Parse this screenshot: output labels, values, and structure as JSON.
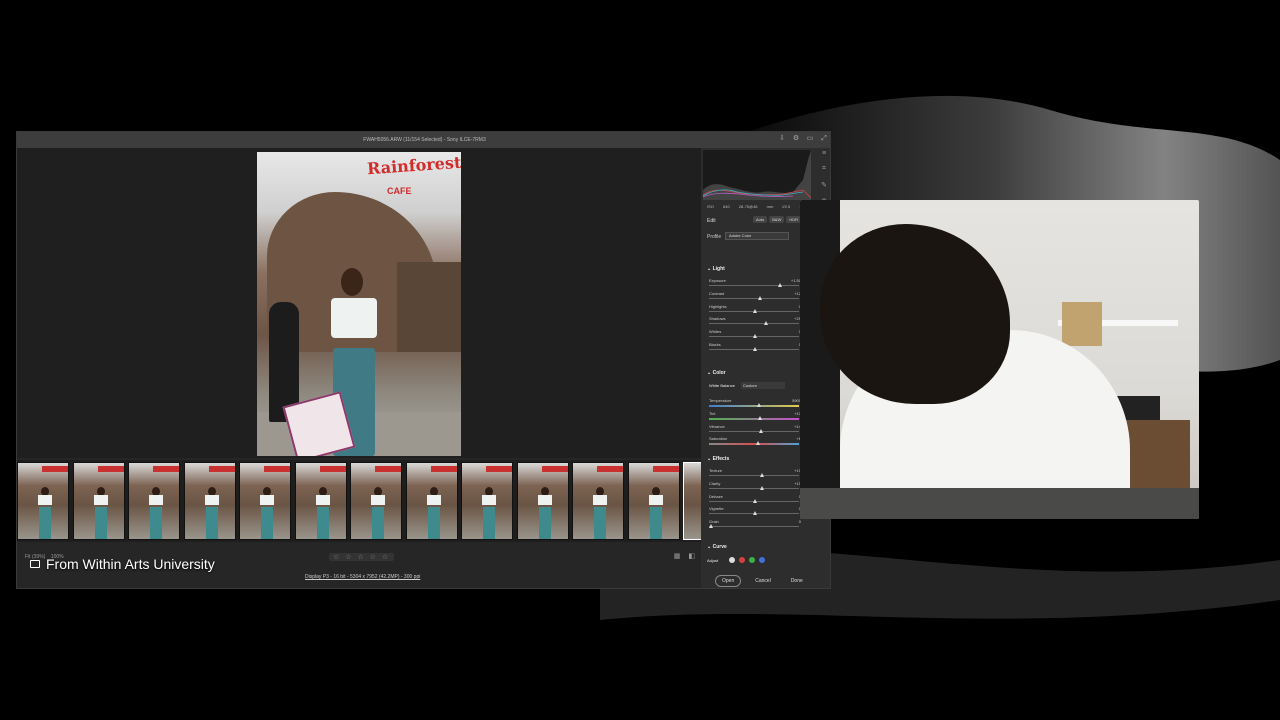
{
  "window": {
    "title": "FWAH5056.ARW (11/154 Selected) - Sony ILCE-7RM3",
    "title_icons": [
      "download-icon",
      "gear-icon",
      "fullscreen-icon",
      "expand-icon"
    ]
  },
  "photo": {
    "sign_text": "Rainforest",
    "sign_sub": "CAFE"
  },
  "filmstrip": {
    "count": 13,
    "selected_index": 12
  },
  "bottom_bar": {
    "zoom_fit": "Fit (39%)",
    "zoom_100": "100%",
    "stars": "☆ ☆ ☆ ☆ ☆",
    "file_info": "Display P3 - 16 bit - 5304 x 7952 (42.2MP) - 300 ppi"
  },
  "panel": {
    "camera_info": "ISO 640  28-75@48 mm  f/2.5  1/250s",
    "edit_label": "Edit",
    "edit_buttons": [
      "Auto",
      "B&W",
      "HDR"
    ],
    "profile_label": "Profile",
    "profile_value": "Adobe Color",
    "light": {
      "header": "Light",
      "sliders": [
        {
          "label": "Exposure",
          "value": "+1.50",
          "pos": 0.78
        },
        {
          "label": "Contrast",
          "value": "+12",
          "pos": 0.56
        },
        {
          "label": "Highlights",
          "value": "0",
          "pos": 0.5
        },
        {
          "label": "Shadows",
          "value": "+25",
          "pos": 0.62
        },
        {
          "label": "Whites",
          "value": "0",
          "pos": 0.5
        },
        {
          "label": "Blacks",
          "value": "0",
          "pos": 0.5
        }
      ]
    },
    "color": {
      "header": "Color",
      "wb_label": "White Balance",
      "wb_value": "Custom",
      "sliders": [
        {
          "label": "Temperature",
          "value": "5900",
          "pos": 0.55
        },
        {
          "label": "Tint",
          "value": "+10",
          "pos": 0.56
        },
        {
          "label": "Vibrance",
          "value": "+14",
          "pos": 0.57
        },
        {
          "label": "Saturation",
          "value": "+6",
          "pos": 0.53
        }
      ]
    },
    "effects": {
      "header": "Effects",
      "sliders": [
        {
          "label": "Texture",
          "value": "+15",
          "pos": 0.58
        },
        {
          "label": "Clarity",
          "value": "+15",
          "pos": 0.58
        },
        {
          "label": "Dehaze",
          "value": "0",
          "pos": 0.5
        },
        {
          "label": "Vignette",
          "value": "0",
          "pos": 0.5
        },
        {
          "label": "Grain",
          "value": "0",
          "pos": 0.0
        }
      ]
    },
    "curve": {
      "header": "Curve",
      "adjust_label": "Adjust",
      "dot_colors": [
        "#dddddd",
        "#d84040",
        "#40b040",
        "#4070d8"
      ]
    },
    "footer": {
      "open": "Open",
      "cancel": "Cancel",
      "done": "Done"
    }
  },
  "watermark": {
    "text": "From Within Arts University"
  }
}
